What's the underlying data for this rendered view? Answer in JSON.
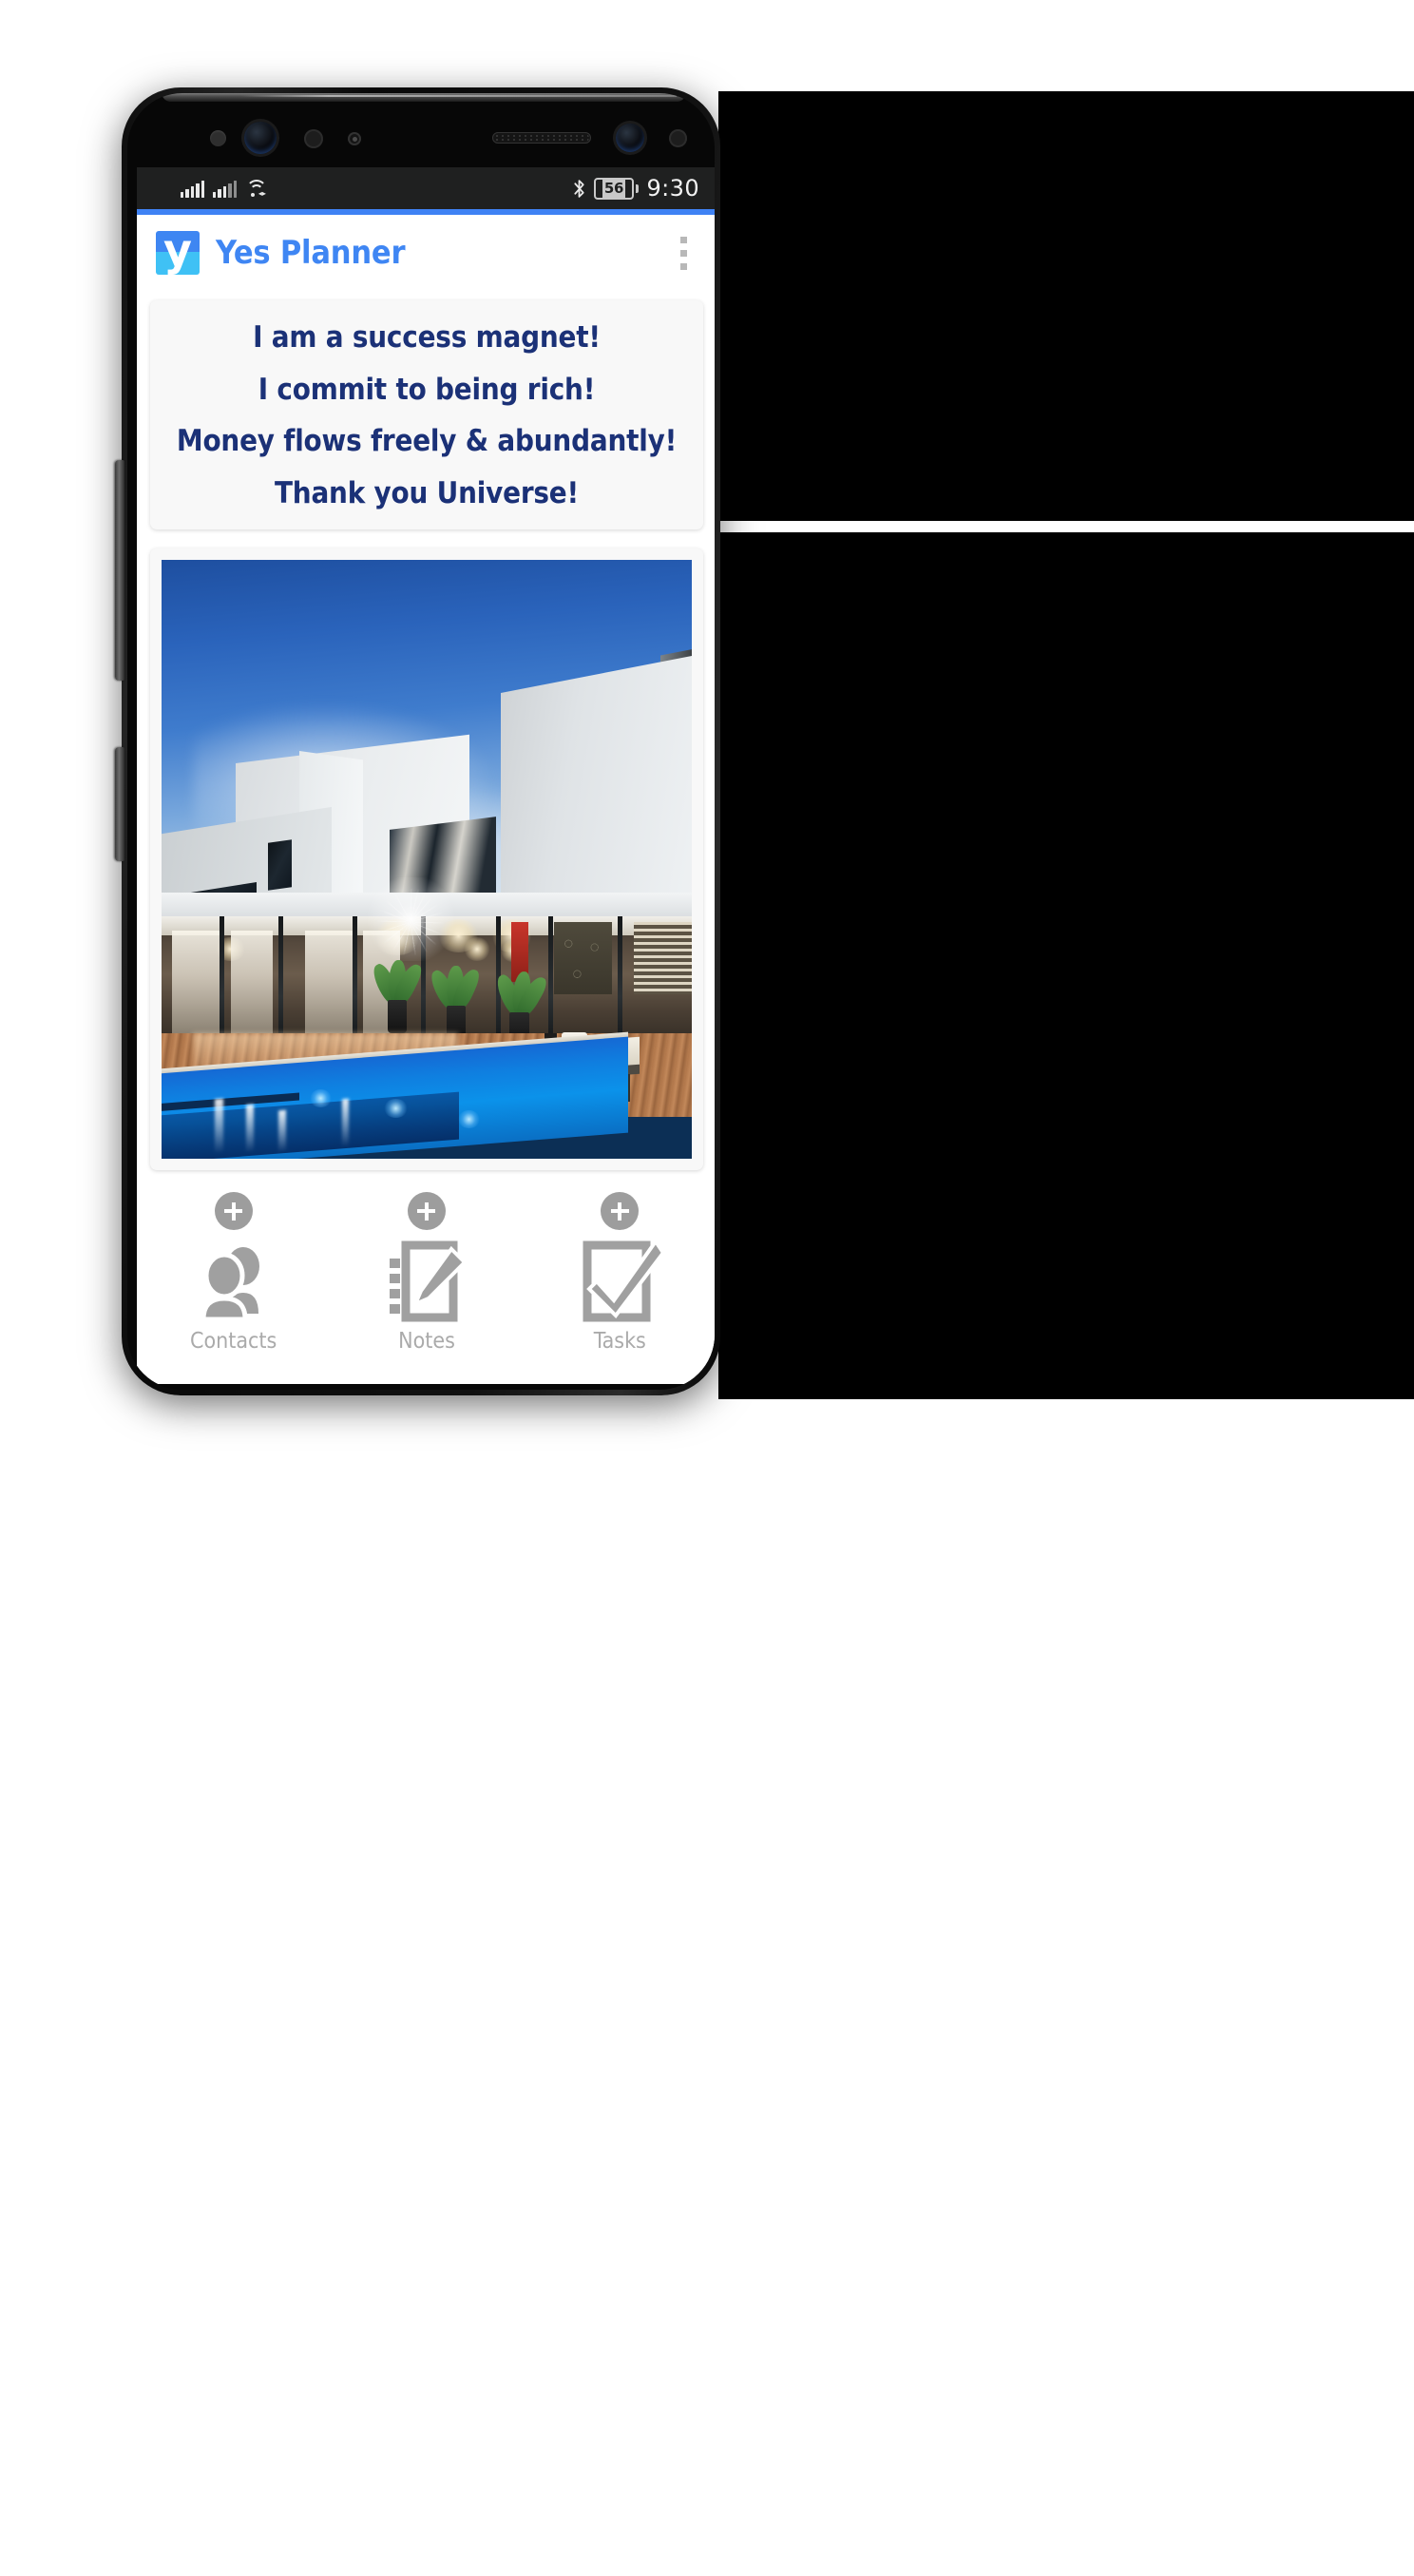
{
  "device": {
    "kind": "android-smartphone",
    "side_buttons": [
      "volume-rocker",
      "power-button"
    ]
  },
  "statusbar": {
    "signal_1_icon": "cellular-signal-icon",
    "signal_2_icon": "cellular-signal-icon",
    "wifi_icon": "wifi-icon",
    "bluetooth_icon": "bluetooth-icon",
    "battery_icon": "battery-icon",
    "battery_level": "56",
    "time": "9:30"
  },
  "appbar": {
    "logo_icon": "yes-planner-logo-icon",
    "logo_glyph": "y",
    "title": "Yes Planner",
    "overflow_icon": "overflow-menu-icon",
    "accent_color": "#3f82f4",
    "title_color": "#3f86f3"
  },
  "affirmations": {
    "text_color": "#1b3177",
    "lines": [
      "I am a success magnet!",
      "I commit to being rich!",
      "Money flows freely & abundantly!",
      "Thank you Universe!"
    ]
  },
  "vision_photo": {
    "alt": "Modern luxury white house with long blue swimming pool and timber deck at dusk",
    "subject": "dream-house-with-pool"
  },
  "bottom_nav": {
    "add_icon": "plus-icon",
    "items": [
      {
        "label": "Contacts",
        "icon": "contacts-people-icon"
      },
      {
        "label": "Notes",
        "icon": "note-pencil-icon"
      },
      {
        "label": "Tasks",
        "icon": "checkbox-check-icon"
      }
    ],
    "label_color": "#aaaaaa",
    "icon_color": "#a0a0a0"
  }
}
